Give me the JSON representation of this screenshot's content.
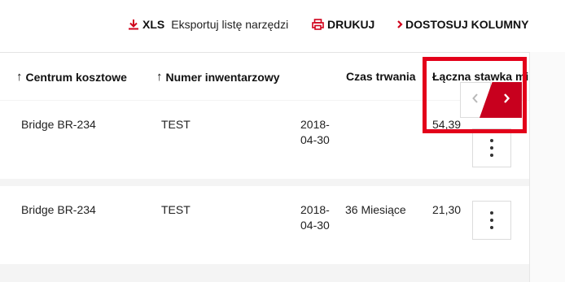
{
  "toolbar": {
    "xls_label": "XLS",
    "export_label": "Eksportuj listę narzędzi",
    "print_label": "DRUKUJ",
    "customize_label": "DOSTOSUJ KOLUMNY"
  },
  "columns": {
    "cost_center": "Centrum kosztowe",
    "inventory_number": "Numer inwentarzowy",
    "duration": "Czas trwania",
    "total_rate": "Łączna stawka mi"
  },
  "rows": [
    {
      "cost_center": "Bridge BR-234",
      "inventory_number": "TEST",
      "date_line1": "2018-",
      "date_line2": "04-30",
      "duration": "",
      "total_rate": "54,39"
    },
    {
      "cost_center": "Bridge BR-234",
      "inventory_number": "TEST",
      "date_line1": "2018-",
      "date_line2": "04-30",
      "duration": "36 Miesiące",
      "total_rate": "21,30"
    }
  ],
  "colors": {
    "accent": "#d0021b",
    "highlight": "#e3001a",
    "nav_next": "#c8001e"
  },
  "icons": {
    "download": "download-icon",
    "print": "printer-icon",
    "customize": "chevron-right-icon",
    "sort": "arrow-up-icon",
    "prev": "chevron-left-icon",
    "next": "chevron-right-icon",
    "menu": "kebab-menu-icon"
  }
}
